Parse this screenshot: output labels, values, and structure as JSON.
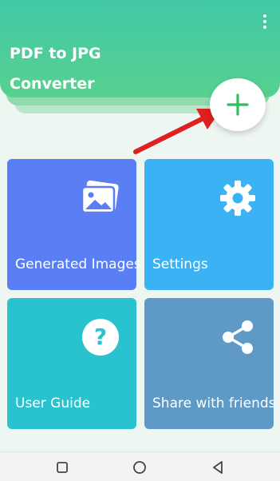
{
  "app": {
    "title": "PDF to JPG\nConverter"
  },
  "tiles": [
    {
      "label": "Generated Images",
      "icon": "image-icon",
      "color": "#5a7ef3"
    },
    {
      "label": "Settings",
      "icon": "gear-icon",
      "color": "#3ab2f4"
    },
    {
      "label": "User Guide",
      "icon": "help-icon",
      "color": "#28c3cf"
    },
    {
      "label": "Share with friends",
      "icon": "share-icon",
      "color": "#5f9ac6"
    }
  ],
  "colors": {
    "header_start": "#41c8a7",
    "header_end": "#57d18f",
    "fab_plus": "#2fbf5f",
    "annotation_arrow": "#e02020"
  },
  "navbar": {
    "buttons": [
      "recents-icon",
      "home-icon",
      "back-icon"
    ]
  }
}
